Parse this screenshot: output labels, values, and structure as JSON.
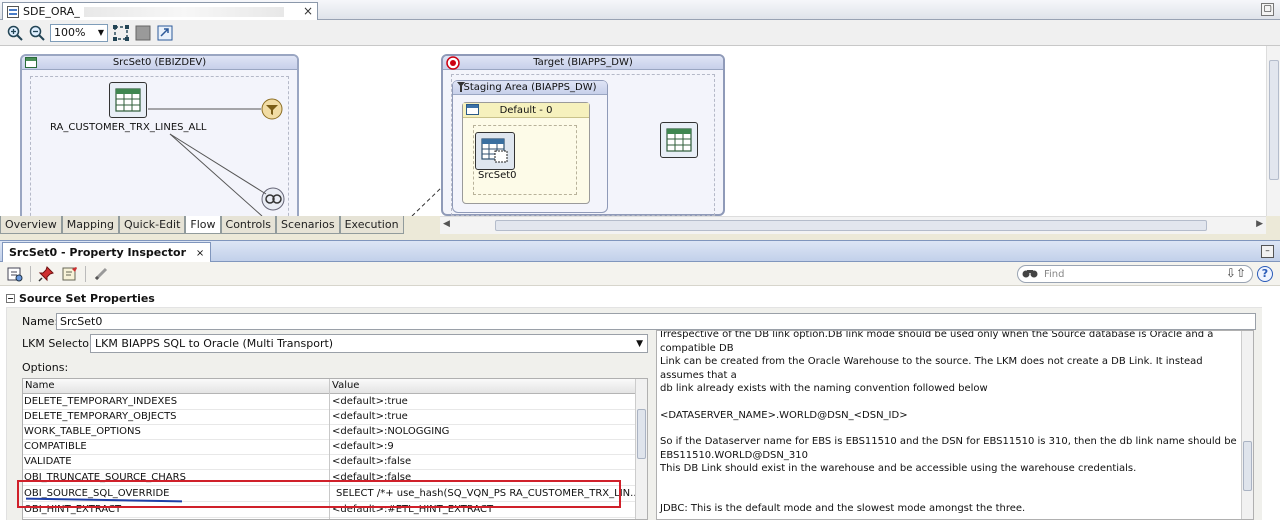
{
  "editor": {
    "tab_title": "SDE_ORA_",
    "zoom": "100%"
  },
  "diagram": {
    "source_group_title": "SrcSet0 (EBIZDEV)",
    "source_table": "RA_CUSTOMER_TRX_LINES_ALL",
    "target_group_title": "Target (BIAPPS_DW)",
    "staging_title": "Staging Area (BIAPPS_DW)",
    "default_title": "Default - 0",
    "srcset_label": "SrcSet0"
  },
  "bottom_tabs": [
    "Overview",
    "Mapping",
    "Quick-Edit",
    "Flow",
    "Controls",
    "Scenarios",
    "Execution"
  ],
  "inspector": {
    "title": "SrcSet0 - Property Inspector",
    "find_placeholder": "Find",
    "help": "?",
    "section_title": "Source Set Properties",
    "name_label": "Name:",
    "name_value": "SrcSet0",
    "lkm_label": "LKM Selector:",
    "lkm_value": "LKM BIAPPS SQL to Oracle (Multi Transport)",
    "options_label": "Options:",
    "col_name": "Name",
    "col_value": "Value",
    "options": [
      {
        "name": "DELETE_TEMPORARY_INDEXES",
        "value": "<default>:true"
      },
      {
        "name": "DELETE_TEMPORARY_OBJECTS",
        "value": "<default>:true"
      },
      {
        "name": "WORK_TABLE_OPTIONS",
        "value": "<default>:NOLOGGING"
      },
      {
        "name": "COMPATIBLE",
        "value": "<default>:9"
      },
      {
        "name": "VALIDATE",
        "value": "<default>:false"
      },
      {
        "name": "OBI_TRUNCATE_SOURCE_CHARS",
        "value": "<default>:false"
      },
      {
        "name": "OBI_SOURCE_SQL_OVERRIDE",
        "value": "SELECT /*+ use_hash(SQ_VQN_PS RA_CUSTOMER_TRX_LIN..."
      },
      {
        "name": "OBI_HINT_EXTRACT",
        "value": "<default>:#ETL_HINT_EXTRACT"
      }
    ],
    "description": {
      "line1": "Irrespective of the DB link option.DB link mode should be used only when the Source database is Oracle and a compatible DB",
      "line2": "Link can be created from the Oracle Warehouse to the source. The LKM does not create a DB Link. It instead assumes that a",
      "line3": "db link already exists with the naming convention followed below",
      "line4": "<DATASERVER_NAME>.WORLD@DSN_<DSN_ID>",
      "line5": "So if the Dataserver name for EBS is EBS11510 and the DSN for EBS11510 is 310, then the db link name should be",
      "line6": "EBS11510.WORLD@DSN_310",
      "line7": "This DB Link should exist in the warehouse and be accessible using the warehouse credentials.",
      "line8": "JDBC: This is the default mode and the slowest mode amongst the three."
    }
  },
  "colors": {
    "highlight": "#d0202a",
    "underline": "#1e3fa8",
    "group_border": "#9aa6c2"
  }
}
